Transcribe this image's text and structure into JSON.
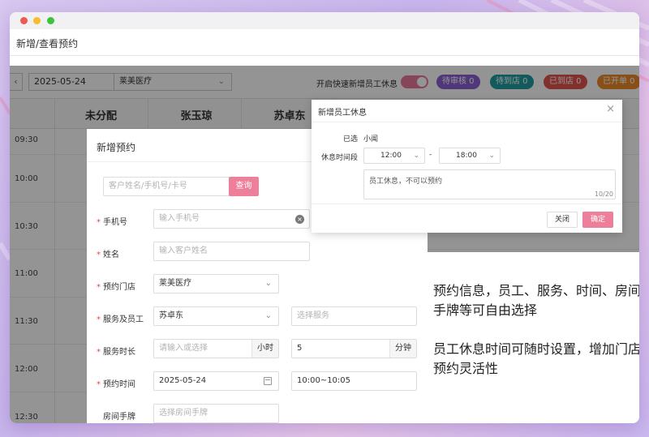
{
  "window": {
    "title": "新增/查看预约"
  },
  "toolbar": {
    "prev_label": "‹",
    "date": "2025-05-24",
    "store": "莱美医疗",
    "quick_rest_label": "开启快速新增员工休息",
    "badges": [
      {
        "label": "待审核 0",
        "color": "#8a5fd0"
      },
      {
        "label": "待到店 0",
        "color": "#1f9c9e"
      },
      {
        "label": "已到店 0",
        "color": "#e0534e"
      },
      {
        "label": "已开单 0",
        "color": "#ea8a2a"
      }
    ]
  },
  "schedule": {
    "columns": [
      "未分配",
      "张玉琼",
      "苏卓东"
    ],
    "times": [
      "09:30",
      "10:00",
      "10:30",
      "11:00",
      "11:30",
      "12:00",
      "12:30"
    ]
  },
  "booking_dialog": {
    "title": "新增预约",
    "search_placeholder": "客户姓名/手机号/卡号",
    "search_button": "查询",
    "phone_label": "手机号",
    "phone_placeholder": "输入手机号",
    "name_label": "姓名",
    "name_placeholder": "输入客户姓名",
    "store_label": "预约门店",
    "store_value": "莱美医疗",
    "staff_label": "服务及员工",
    "staff_value": "苏卓东",
    "service_placeholder": "选择服务",
    "duration_label": "服务时长",
    "duration_hours_placeholder": "请输入或选择",
    "hours_unit": "小时",
    "duration_minutes_value": "5",
    "minutes_unit": "分钟",
    "time_label": "预约时间",
    "date_value": "2025-05-24",
    "time_range_value": "10:00~10:05",
    "room_label": "房间手牌",
    "room_placeholder": "选择房间手牌"
  },
  "rest_dialog": {
    "title": "新增员工休息",
    "selected_label": "已选",
    "selected_value": "小闻",
    "period_label": "休息时间段",
    "start_time": "12:00",
    "dash": "-",
    "end_time": "18:00",
    "note": "员工休息，不可以预约",
    "counter": "10/20",
    "cancel_label": "关闭",
    "ok_label": "确定"
  },
  "callouts": {
    "line1": "预约信息，员工、服务、时间、房间手牌等可自由选择",
    "line2": "员工休息时间可随时设置，增加门店预约灵活性"
  }
}
